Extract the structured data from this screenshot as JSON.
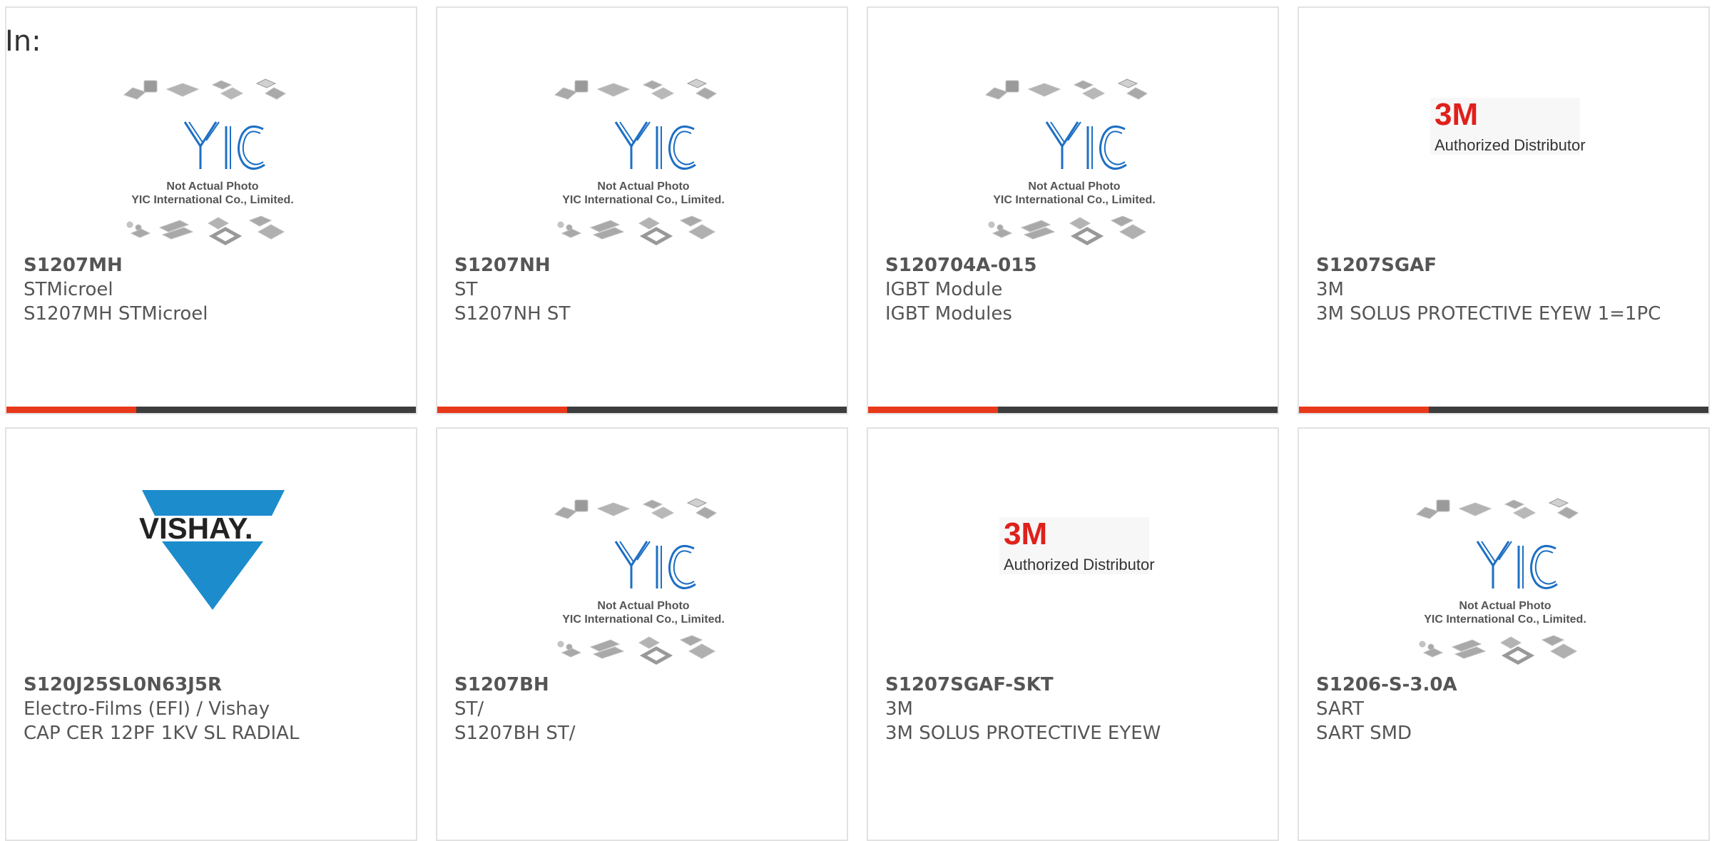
{
  "header": {
    "label": "In:"
  },
  "placeholder": {
    "line1": "Not Actual Photo",
    "line2": "YIC International Co., Limited."
  },
  "brands": {
    "three_m": {
      "logo": "3M",
      "tagline": "Authorized Distributor"
    },
    "vishay": {
      "logo": "VISHAY."
    }
  },
  "colors": {
    "accent": "#e8391b",
    "bar": "#3d3d3d",
    "vishay_blue": "#1c8ccc",
    "three_m_red": "#e0201b",
    "yic_blue": "#1e6fc4"
  },
  "products": [
    {
      "part": "S1207MH",
      "mfr": "STMicroel",
      "desc": "S1207MH STMicroel",
      "image": "yic-placeholder"
    },
    {
      "part": "S1207NH",
      "mfr": "ST",
      "desc": "S1207NH ST",
      "image": "yic-placeholder"
    },
    {
      "part": "S120704A-015",
      "mfr": "IGBT Module",
      "desc": "IGBT Modules",
      "image": "yic-placeholder"
    },
    {
      "part": "S1207SGAF",
      "mfr": "3M",
      "desc": "3M SOLUS PROTECTIVE EYEW 1=1PC",
      "image": "3m-logo"
    },
    {
      "part": "S120J25SL0N63J5R",
      "mfr": "Electro-Films (EFI) / Vishay",
      "desc": "CAP CER 12PF 1KV SL RADIAL",
      "image": "vishay-logo"
    },
    {
      "part": "S1207BH",
      "mfr": "ST/",
      "desc": "S1207BH ST/",
      "image": "yic-placeholder"
    },
    {
      "part": "S1207SGAF-SKT",
      "mfr": "3M",
      "desc": "3M SOLUS PROTECTIVE EYEW",
      "image": "3m-logo"
    },
    {
      "part": "S1206-S-3.0A",
      "mfr": "SART",
      "desc": "SART SMD",
      "image": "yic-placeholder"
    }
  ]
}
